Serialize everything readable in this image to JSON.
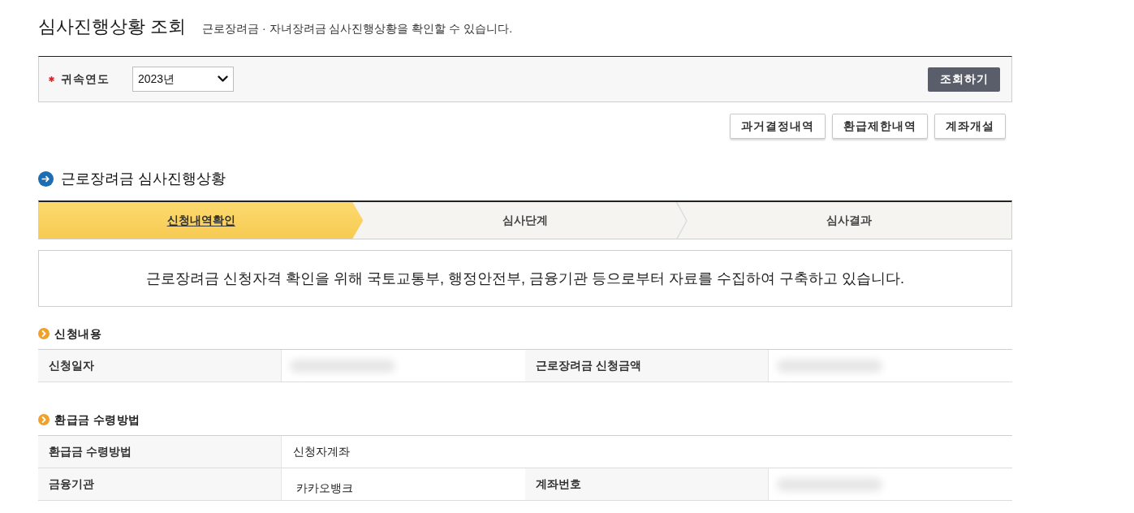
{
  "page": {
    "title": "심사진행상황 조회",
    "subtitle": "근로장려금 · 자녀장려금 심사진행상황을 확인할 수 있습니다."
  },
  "search": {
    "field_label": "귀속연도",
    "required": true,
    "year_select": {
      "value": "2023년"
    },
    "submit_button": "조회하기"
  },
  "action_buttons": [
    "과거결정내역",
    "환급제한내역",
    "계좌개설"
  ],
  "progress": {
    "heading": "근로장려금 심사진행상황",
    "steps": [
      {
        "label": "신청내역확인",
        "selected": true
      },
      {
        "label": "심사단계",
        "selected": false
      },
      {
        "label": "심사결과",
        "selected": false
      }
    ],
    "message": "근로장려금 신청자격 확인을 위해 국토교통부, 행정안전부, 금융기관 등으로부터 자료를 수집하여 구축하고 있습니다."
  },
  "sections": [
    {
      "heading": "신청내용",
      "rows": [
        [
          {
            "kind": "header",
            "text": "신청일자"
          },
          {
            "kind": "redacted"
          },
          {
            "kind": "header",
            "text": "근로장려금 신청금액"
          },
          {
            "kind": "redacted"
          }
        ]
      ]
    },
    {
      "heading": "환급금 수령방법",
      "rows": [
        [
          {
            "kind": "header",
            "text": "환급금 수령방법"
          },
          {
            "kind": "value",
            "text": "신청자계좌"
          }
        ],
        [
          {
            "kind": "header",
            "text": "금융기관"
          },
          {
            "kind": "value",
            "text": "카카오뱅크"
          },
          {
            "kind": "header",
            "text": "계좌번호"
          },
          {
            "kind": "redacted"
          }
        ]
      ]
    }
  ]
}
